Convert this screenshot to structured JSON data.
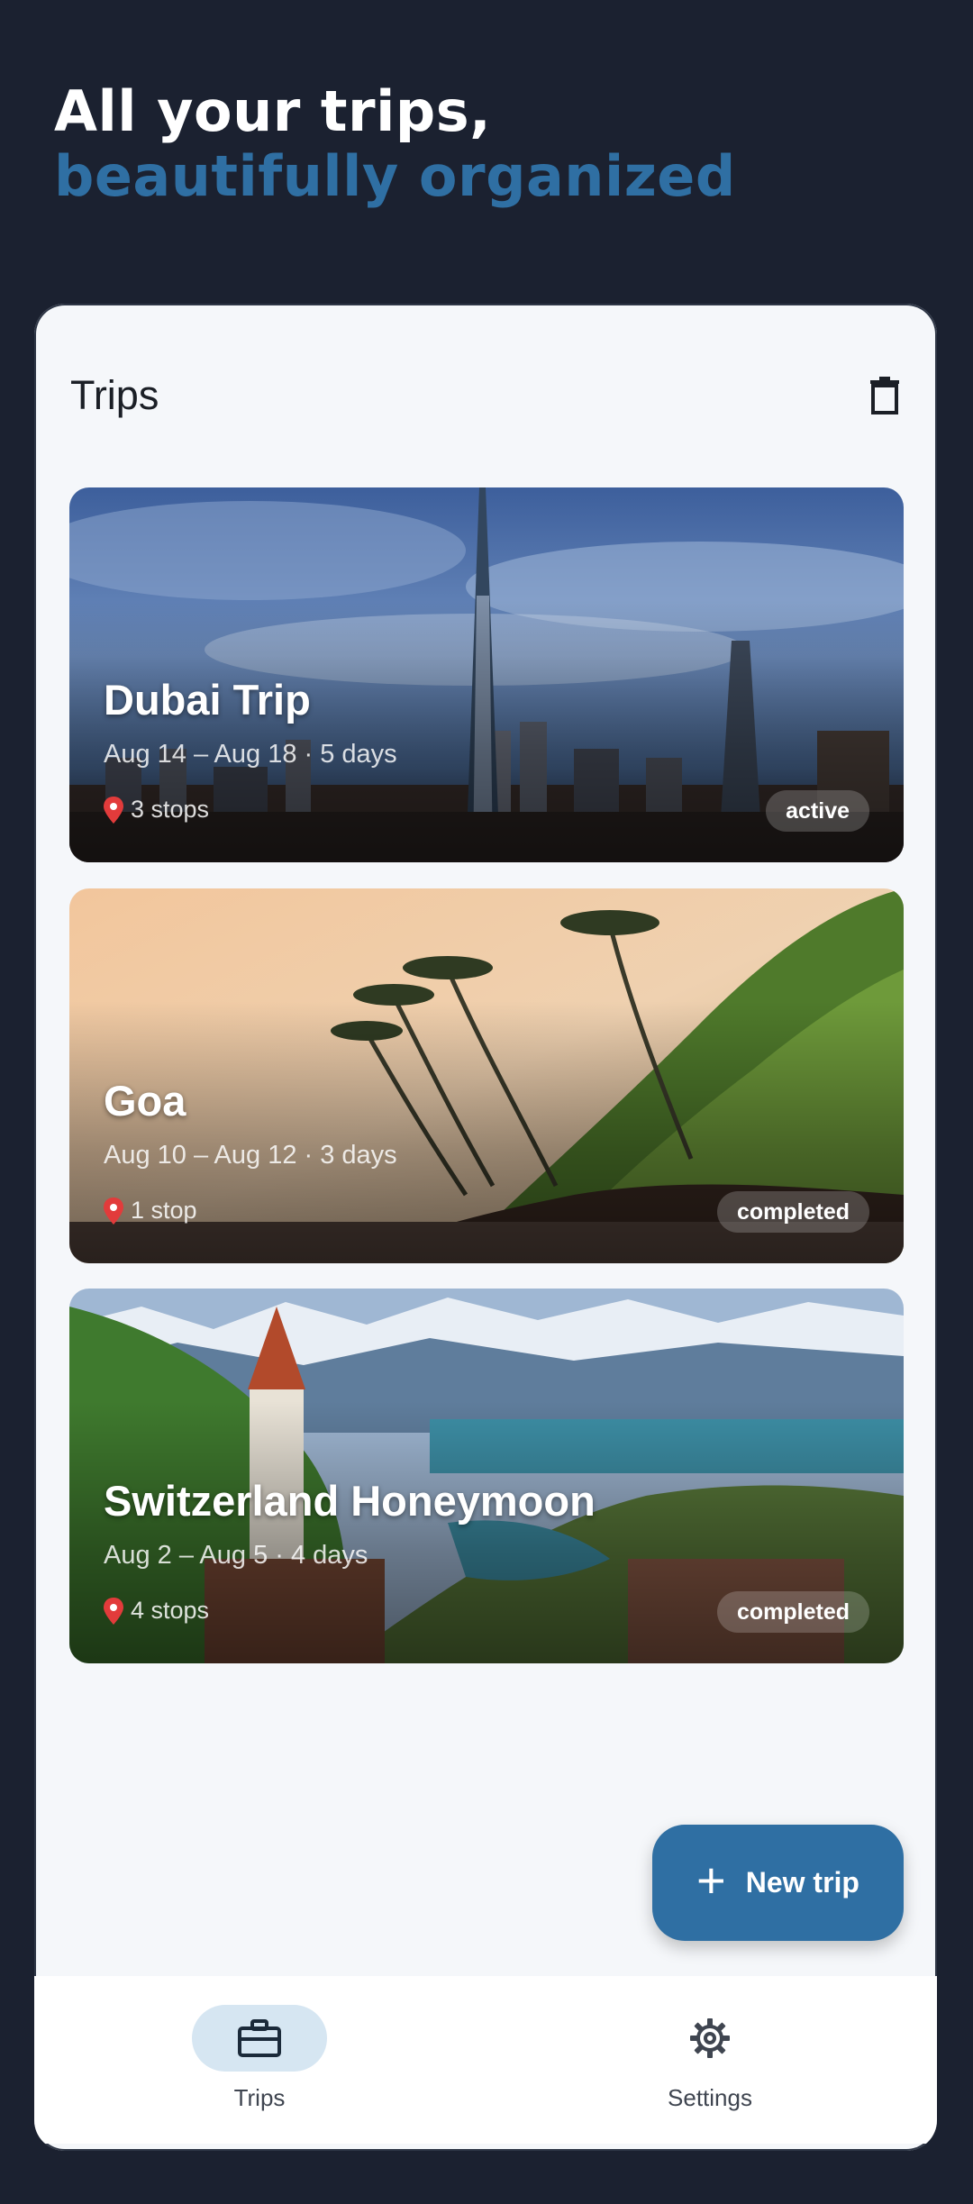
{
  "headline": {
    "line1": "All your trips,",
    "line2": "beautifully organized"
  },
  "topbar": {
    "title": "Trips",
    "action_icon": "trash-icon"
  },
  "trips": [
    {
      "title": "Dubai Trip",
      "dates": "Aug 14 – Aug 18 · 5 days",
      "stops": "3 stops",
      "status": "active"
    },
    {
      "title": "Goa",
      "dates": "Aug 10 – Aug 12 · 3 days",
      "stops": "1 stop",
      "status": "completed"
    },
    {
      "title": "Switzerland Honeymoon",
      "dates": "Aug 2 – Aug 5 · 4 days",
      "stops": "4 stops",
      "status": "completed"
    }
  ],
  "fab": {
    "label": "New trip",
    "icon": "plus-icon"
  },
  "nav": [
    {
      "label": "Trips",
      "icon": "briefcase-icon",
      "active": true
    },
    {
      "label": "Settings",
      "icon": "gear-icon",
      "active": false
    }
  ],
  "colors": {
    "background": "#1b2130",
    "accent": "#2f6fa3",
    "surface": "#f5f7fa",
    "nav_active": "#d6e6f2"
  }
}
